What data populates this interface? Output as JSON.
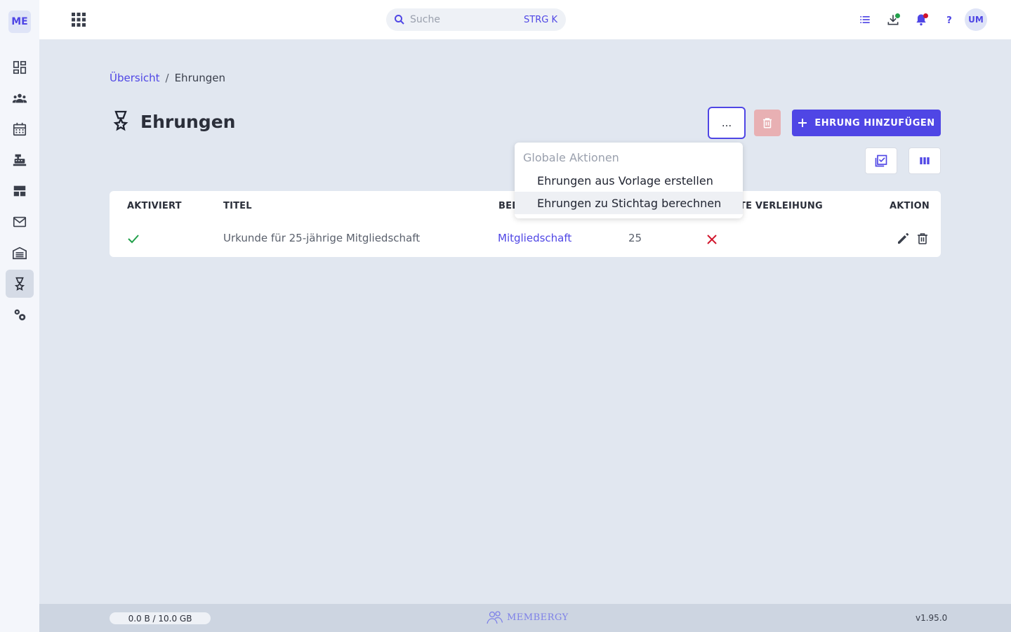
{
  "app": {
    "logo": "ME",
    "version": "v1.95.0",
    "brand": "MEMBERGY"
  },
  "colors": {
    "accent": "#4f46e5",
    "danger": "#d1132a",
    "success": "#22a04b",
    "background": "#e1e7f0"
  },
  "sidebar": {
    "items": [
      {
        "icon": "dashboard-icon"
      },
      {
        "icon": "members-icon"
      },
      {
        "icon": "calendar-icon"
      },
      {
        "icon": "cash-register-icon"
      },
      {
        "icon": "layout-icon"
      },
      {
        "icon": "mail-icon"
      },
      {
        "icon": "warehouse-icon"
      },
      {
        "icon": "award-icon",
        "active": true
      },
      {
        "icon": "settings-icon"
      }
    ]
  },
  "topbar": {
    "search_placeholder": "Suche",
    "search_shortcut": "STRG K",
    "avatar": "UM"
  },
  "breadcrumb": {
    "root": "Übersicht",
    "separator": "/",
    "current": "Ehrungen"
  },
  "page": {
    "title": "Ehrungen",
    "more_label": "...",
    "add_label": "EHRUNG HINZUFÜGEN"
  },
  "table": {
    "columns": [
      "AKTIVIERT",
      "TITEL",
      "BED",
      "TE VERLEIHUNG",
      "AKTION"
    ],
    "rows": [
      {
        "activated": true,
        "title": "Urkunde für 25-jährige Mitgliedschaft",
        "condition": "Mitgliedschaft",
        "value": "25",
        "flag": false
      }
    ]
  },
  "menu": {
    "header": "Globale Aktionen",
    "items": [
      "Ehrungen aus Vorlage erstellen",
      "Ehrungen zu Stichtag berechnen"
    ]
  },
  "footer": {
    "storage": "0.0 B / 10.0 GB"
  }
}
